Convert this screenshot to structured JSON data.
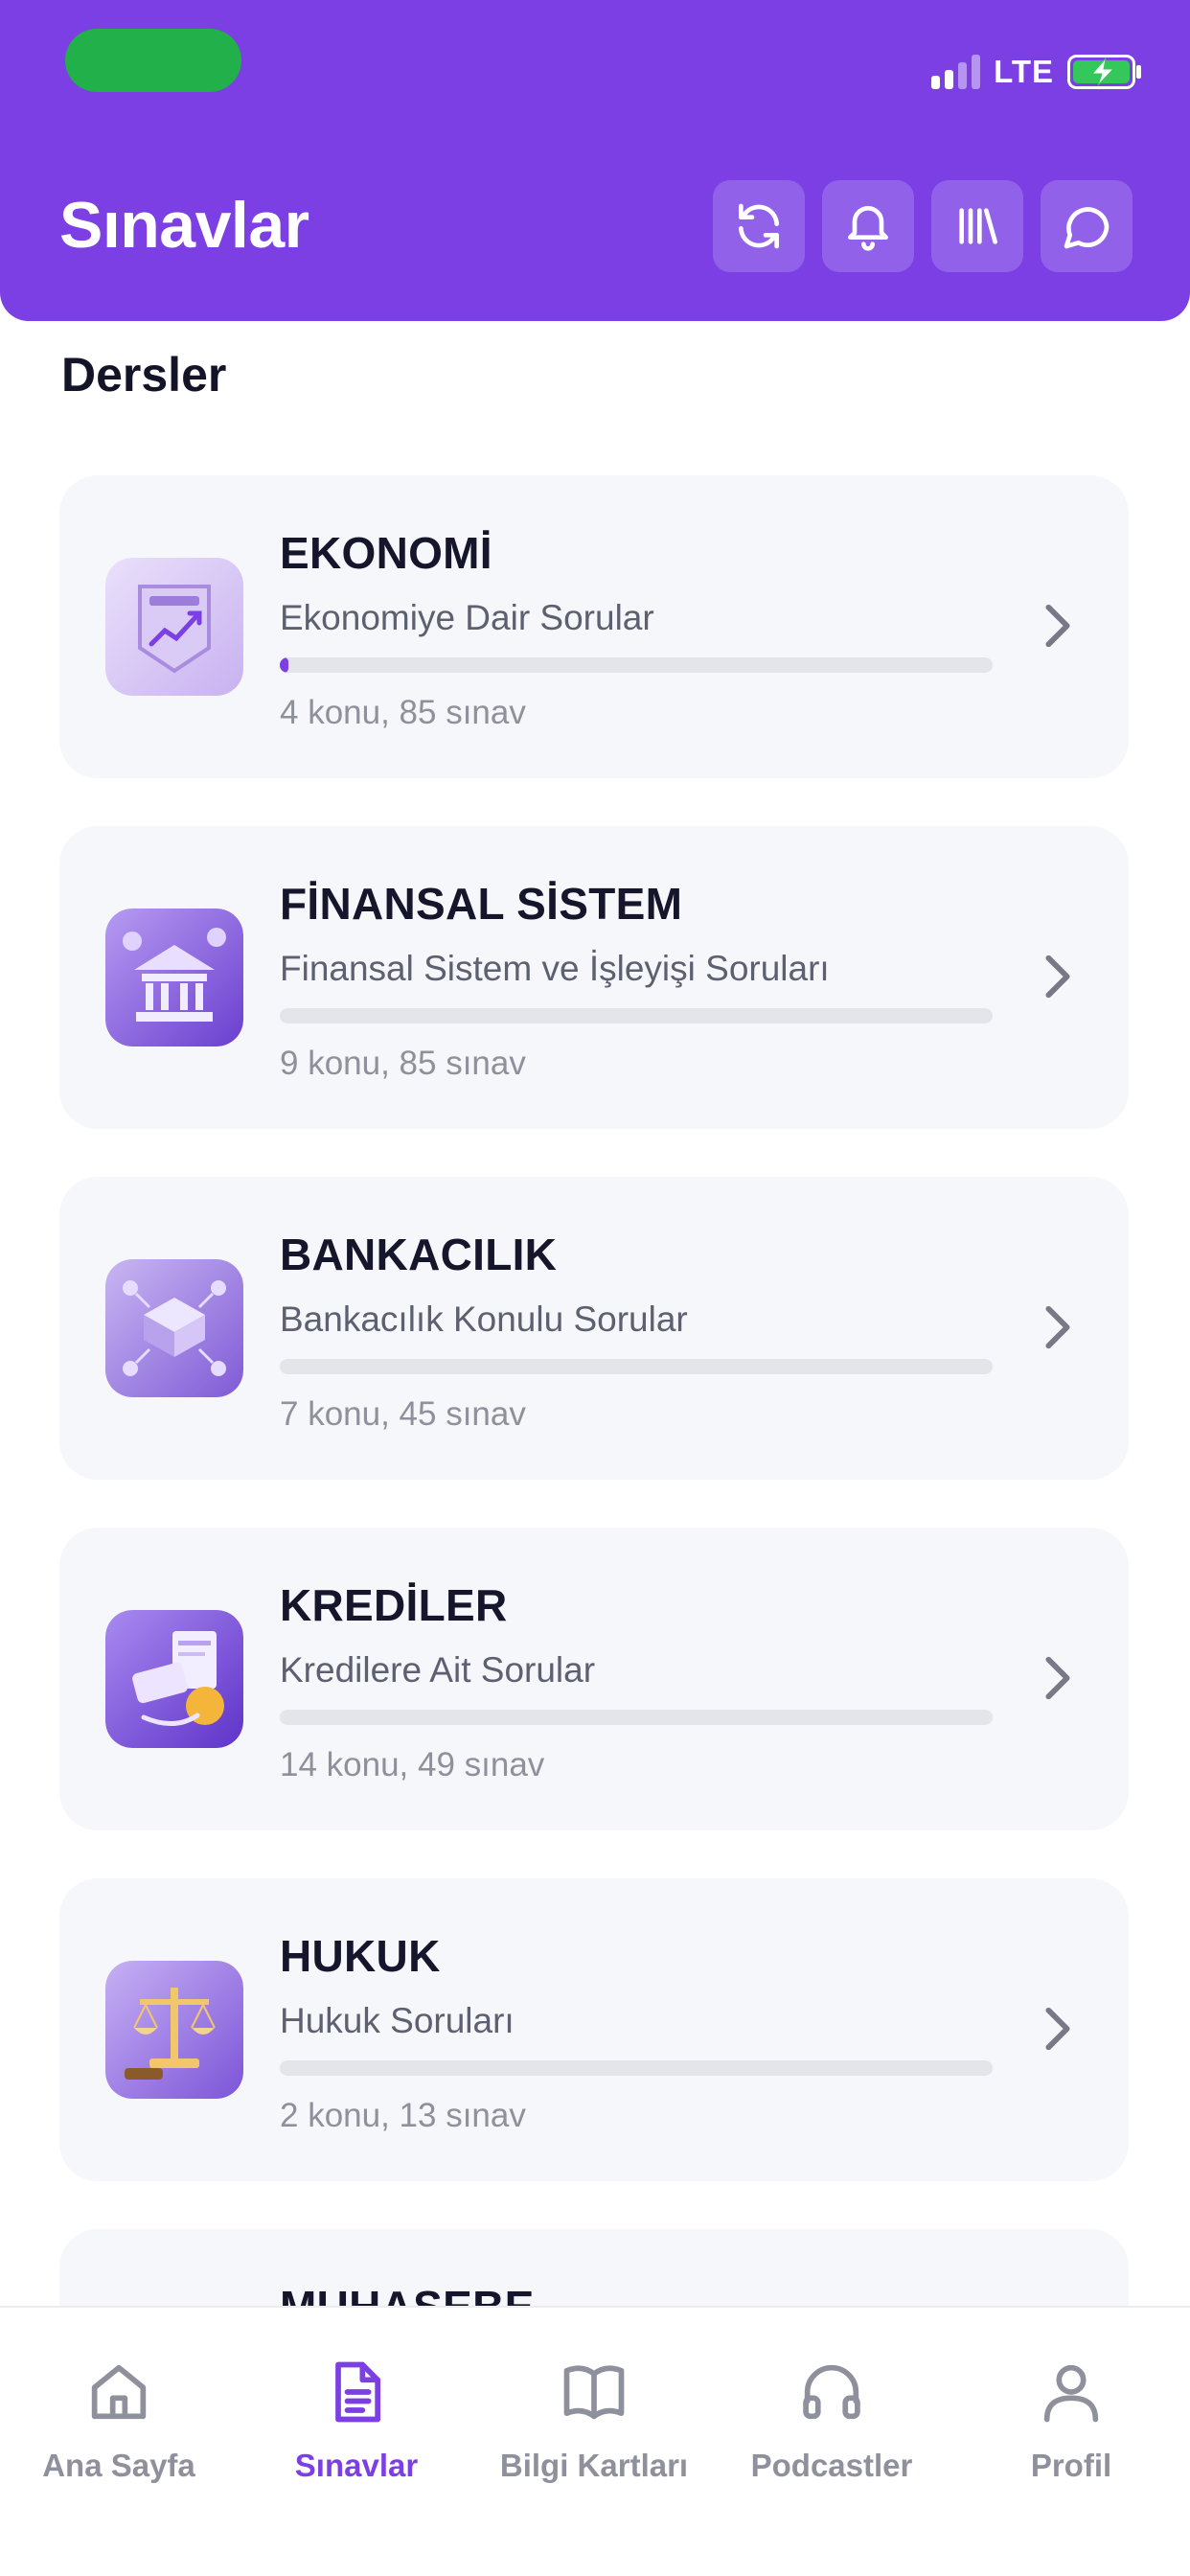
{
  "status_bar": {
    "network": "LTE"
  },
  "header": {
    "title": "Sınavlar",
    "actions": [
      {
        "icon": "refresh-icon"
      },
      {
        "icon": "bell-icon"
      },
      {
        "icon": "library-icon"
      },
      {
        "icon": "chat-icon"
      }
    ],
    "background_color": "#7B3FE4"
  },
  "section": {
    "title": "Dersler"
  },
  "courses": [
    {
      "title": "EKONOMİ",
      "subtitle": "Ekonomiye Dair Sorular",
      "meta": "4 konu, 85 sınav",
      "progress": 0.01,
      "icon": "economy-icon"
    },
    {
      "title": "FİNANSAL SİSTEM",
      "subtitle": "Finansal Sistem ve İşleyişi Soruları",
      "meta": "9 konu, 85 sınav",
      "progress": 0,
      "icon": "bank-building-icon"
    },
    {
      "title": "BANKACILIK",
      "subtitle": "Bankacılık Konulu Sorular",
      "meta": "7 konu, 45 sınav",
      "progress": 0,
      "icon": "banking-network-icon"
    },
    {
      "title": "KREDİLER",
      "subtitle": "Kredilere Ait Sorular",
      "meta": "14 konu, 49 sınav",
      "progress": 0,
      "icon": "credit-icon"
    },
    {
      "title": "HUKUK",
      "subtitle": "Hukuk Soruları",
      "meta": "2 konu, 13 sınav",
      "progress": 0,
      "icon": "law-scales-icon"
    },
    {
      "title": "MUHASEBE",
      "subtitle": "",
      "meta": "",
      "progress": 0,
      "icon": "accounting-icon"
    }
  ],
  "bottom_nav": [
    {
      "label": "Ana Sayfa",
      "icon": "home-icon",
      "active": false
    },
    {
      "label": "Sınavlar",
      "icon": "document-icon",
      "active": true
    },
    {
      "label": "Bilgi Kartları",
      "icon": "book-icon",
      "active": false
    },
    {
      "label": "Podcastler",
      "icon": "headphones-icon",
      "active": false
    },
    {
      "label": "Profil",
      "icon": "user-icon",
      "active": false
    }
  ],
  "colors": {
    "accent": "#7B3FE4",
    "card_bg": "#F6F7FA",
    "muted": "#8E909C"
  }
}
